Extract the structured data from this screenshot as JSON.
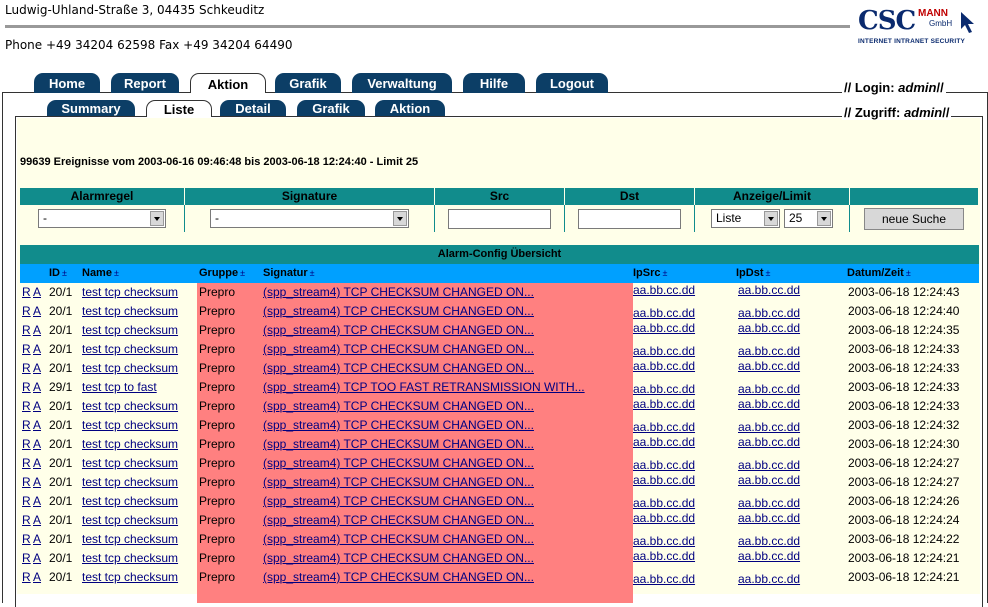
{
  "header": {
    "address": "Ludwig-Uhland-Straße 3, 04435 Schkeuditz",
    "phone": "Phone +49 34204 62598 Fax +49 34204 64490"
  },
  "logo": {
    "big": "CSC",
    "mann": "MANN",
    "gmbh": "GmbH",
    "sub": "INTERNET INTRANET SECURITY"
  },
  "tabs_main": [
    {
      "label": "Home"
    },
    {
      "label": "Report"
    },
    {
      "label": "Aktion"
    },
    {
      "label": "Grafik"
    },
    {
      "label": "Verwaltung"
    },
    {
      "label": "Hilfe"
    },
    {
      "label": "Logout"
    }
  ],
  "tabs_sub": [
    {
      "label": "Summary"
    },
    {
      "label": "Liste"
    },
    {
      "label": "Detail"
    },
    {
      "label": "Grafik"
    },
    {
      "label": "Aktion"
    }
  ],
  "login": {
    "label": "// Login:",
    "user": "admin",
    "tail": "//"
  },
  "zugriff": {
    "label": "// Zugriff:",
    "user": "admin",
    "tail": "//"
  },
  "events_summary": "99639 Ereignisse vom 2003-06-16 09:46:48 bis 2003-06-18 12:24:40 - Limit 25",
  "filter": {
    "headers": [
      "Alarmregel",
      "Signature",
      "Src",
      "Dst",
      "Anzeige/Limit",
      ""
    ],
    "alarmregel_value": "-",
    "signature_value": "-",
    "src_value": "",
    "dst_value": "",
    "anzeige_value": "Liste",
    "limit_value": "25",
    "search_button": "neue Suche"
  },
  "table": {
    "title": "Alarm-Config Übersicht",
    "columns": {
      "id": "ID",
      "name": "Name",
      "gruppe": "Gruppe",
      "signatur": "Signatur",
      "ipsrc": "IpSrc",
      "ipdst": "IpDst",
      "datum": "Datum/Zeit",
      "sort": "±"
    },
    "rows": [
      {
        "r": "R",
        "a": "A",
        "id": "20/1",
        "name": "test tcp checksum",
        "gruppe": "Prepro",
        "sig": "(spp_stream4) TCP CHECKSUM CHANGED ON...",
        "src": "aa.bb.cc.dd",
        "dst": "aa.bb.cc.dd",
        "dt": "2003-06-18 12:24:43"
      },
      {
        "r": "R",
        "a": "A",
        "id": "20/1",
        "name": "test tcp checksum",
        "gruppe": "Prepro",
        "sig": "(spp_stream4) TCP CHECKSUM CHANGED ON...",
        "src": "aa.bb.cc.dd",
        "dst": "aa.bb.cc.dd",
        "dt": "2003-06-18 12:24:40"
      },
      {
        "r": "R",
        "a": "A",
        "id": "20/1",
        "name": "test tcp checksum",
        "gruppe": "Prepro",
        "sig": "(spp_stream4) TCP CHECKSUM CHANGED ON...",
        "src": "aa.bb.cc.dd",
        "dst": "aa.bb.cc.dd",
        "dt": "2003-06-18 12:24:35"
      },
      {
        "r": "R",
        "a": "A",
        "id": "20/1",
        "name": "test tcp checksum",
        "gruppe": "Prepro",
        "sig": "(spp_stream4) TCP CHECKSUM CHANGED ON...",
        "src": "aa.bb.cc.dd",
        "dst": "aa.bb.cc.dd",
        "dt": "2003-06-18 12:24:33"
      },
      {
        "r": "R",
        "a": "A",
        "id": "20/1",
        "name": "test tcp checksum",
        "gruppe": "Prepro",
        "sig": "(spp_stream4) TCP CHECKSUM CHANGED ON...",
        "src": "aa.bb.cc.dd",
        "dst": "aa.bb.cc.dd",
        "dt": "2003-06-18 12:24:33"
      },
      {
        "r": "R",
        "a": "A",
        "id": "29/1",
        "name": "test tcp to fast",
        "gruppe": "Prepro",
        "sig": "(spp_stream4) TCP TOO FAST RETRANSMISSION WITH...",
        "src": "aa.bb.cc.dd",
        "dst": "aa.bb.cc.dd",
        "dt": "2003-06-18 12:24:33"
      },
      {
        "r": "R",
        "a": "A",
        "id": "20/1",
        "name": "test tcp checksum",
        "gruppe": "Prepro",
        "sig": "(spp_stream4) TCP CHECKSUM CHANGED ON...",
        "src": "aa.bb.cc.dd",
        "dst": "aa.bb.cc.dd",
        "dt": "2003-06-18 12:24:33"
      },
      {
        "r": "R",
        "a": "A",
        "id": "20/1",
        "name": "test tcp checksum",
        "gruppe": "Prepro",
        "sig": "(spp_stream4) TCP CHECKSUM CHANGED ON...",
        "src": "aa.bb.cc.dd",
        "dst": "aa.bb.cc.dd",
        "dt": "2003-06-18 12:24:32"
      },
      {
        "r": "R",
        "a": "A",
        "id": "20/1",
        "name": "test tcp checksum",
        "gruppe": "Prepro",
        "sig": "(spp_stream4) TCP CHECKSUM CHANGED ON...",
        "src": "aa.bb.cc.dd",
        "dst": "aa.bb.cc.dd",
        "dt": "2003-06-18 12:24:30"
      },
      {
        "r": "R",
        "a": "A",
        "id": "20/1",
        "name": "test tcp checksum",
        "gruppe": "Prepro",
        "sig": "(spp_stream4) TCP CHECKSUM CHANGED ON...",
        "src": "aa.bb.cc.dd",
        "dst": "aa.bb.cc.dd",
        "dt": "2003-06-18 12:24:27"
      },
      {
        "r": "R",
        "a": "A",
        "id": "20/1",
        "name": "test tcp checksum",
        "gruppe": "Prepro",
        "sig": "(spp_stream4) TCP CHECKSUM CHANGED ON...",
        "src": "aa.bb.cc.dd",
        "dst": "aa.bb.cc.dd",
        "dt": "2003-06-18 12:24:27"
      },
      {
        "r": "R",
        "a": "A",
        "id": "20/1",
        "name": "test tcp checksum",
        "gruppe": "Prepro",
        "sig": "(spp_stream4) TCP CHECKSUM CHANGED ON...",
        "src": "aa.bb.cc.dd",
        "dst": "aa.bb.cc.dd",
        "dt": "2003-06-18 12:24:26"
      },
      {
        "r": "R",
        "a": "A",
        "id": "20/1",
        "name": "test tcp checksum",
        "gruppe": "Prepro",
        "sig": "(spp_stream4) TCP CHECKSUM CHANGED ON...",
        "src": "aa.bb.cc.dd",
        "dst": "aa.bb.cc.dd",
        "dt": "2003-06-18 12:24:24"
      },
      {
        "r": "R",
        "a": "A",
        "id": "20/1",
        "name": "test tcp checksum",
        "gruppe": "Prepro",
        "sig": "(spp_stream4) TCP CHECKSUM CHANGED ON...",
        "src": "aa.bb.cc.dd",
        "dst": "aa.bb.cc.dd",
        "dt": "2003-06-18 12:24:22"
      },
      {
        "r": "R",
        "a": "A",
        "id": "20/1",
        "name": "test tcp checksum",
        "gruppe": "Prepro",
        "sig": "(spp_stream4) TCP CHECKSUM CHANGED ON...",
        "src": "aa.bb.cc.dd",
        "dst": "aa.bb.cc.dd",
        "dt": "2003-06-18 12:24:21"
      },
      {
        "r": "R",
        "a": "A",
        "id": "20/1",
        "name": "test tcp checksum",
        "gruppe": "Prepro",
        "sig": "(spp_stream4) TCP CHECKSUM CHANGED ON...",
        "src": "aa.bb.cc.dd",
        "dst": "aa.bb.cc.dd",
        "dt": "2003-06-18 12:24:21"
      }
    ]
  }
}
